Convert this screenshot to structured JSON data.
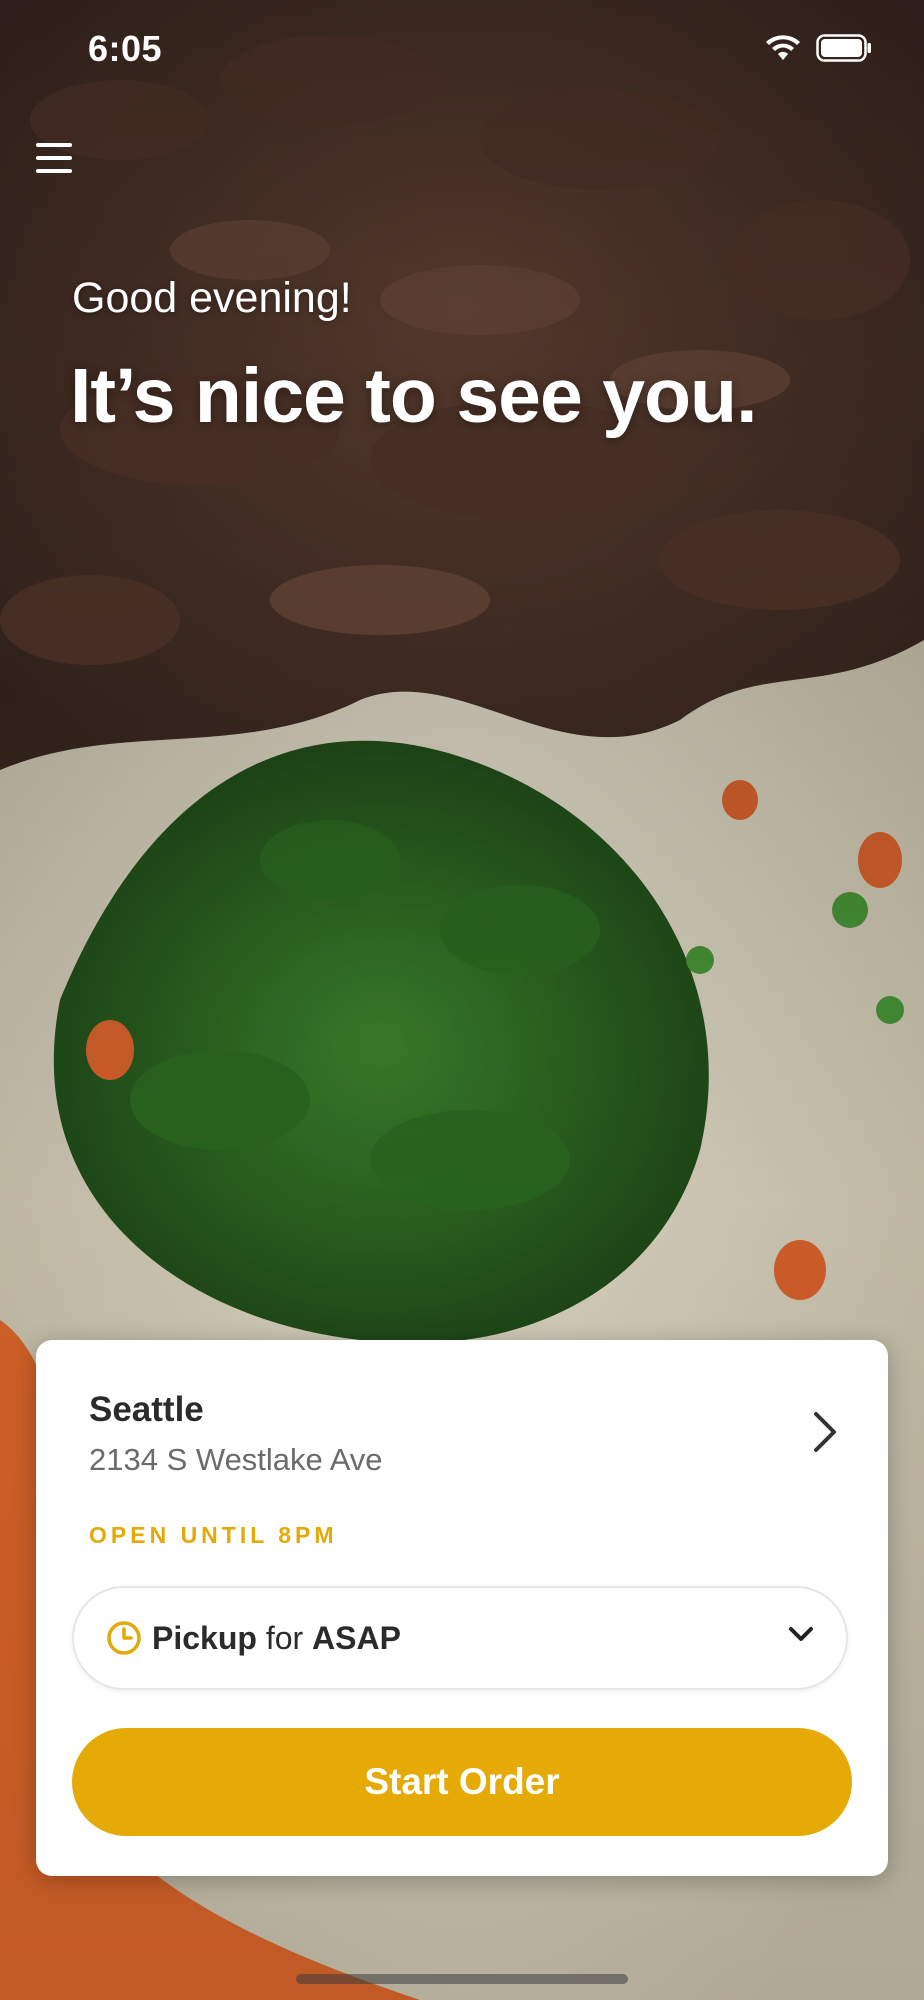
{
  "status_bar": {
    "time": "6:05",
    "wifi_icon": "wifi-icon",
    "battery_icon": "battery-icon"
  },
  "header": {
    "menu_icon": "hamburger-menu-icon",
    "greeting": "Good evening!",
    "headline": "It’s nice to see you."
  },
  "location": {
    "city": "Seattle",
    "address": "2134 S Westlake Ave",
    "hours": "OPEN UNTIL 8PM",
    "chevron_icon": "chevron-right-icon"
  },
  "pickup": {
    "icon": "clock-icon",
    "mode": "Pickup",
    "connector": "for",
    "time": "ASAP",
    "chevron_icon": "chevron-down-icon"
  },
  "actions": {
    "start_order": "Start Order"
  },
  "colors": {
    "accent": "#e5aa05",
    "hours_text": "#e2aa08",
    "city_text": "#2b2b2b",
    "address_text": "#6b6b6b"
  }
}
